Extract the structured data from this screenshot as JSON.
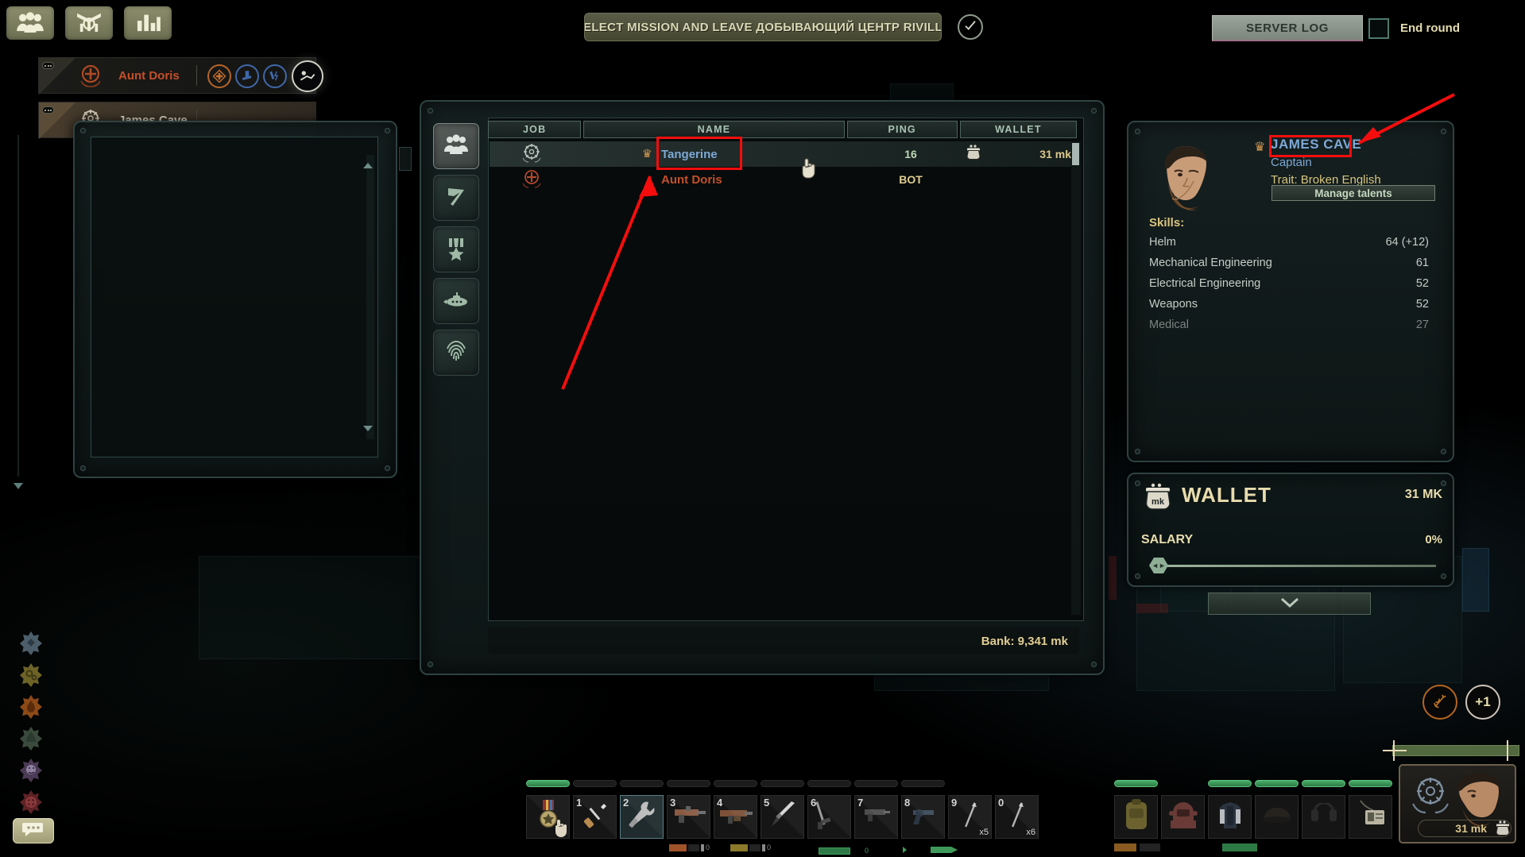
{
  "top_bar": {
    "icon_buttons": [
      {
        "name": "crew-icon",
        "label": "Crew"
      },
      {
        "name": "ship-command-icon",
        "label": "Command"
      },
      {
        "name": "stats-icon",
        "label": "Statistics"
      }
    ],
    "mission_banner": "SELECT MISSION AND LEAVE ДОБЫВАЮЩИЙ ЦЕНТР RIVILLE",
    "mission_check_icon": "check-circle-icon",
    "server_log_label": "SERVER LOG",
    "end_round_label": "End round",
    "end_round_checked": false
  },
  "crew_status_strips": [
    {
      "name": "Aunt Doris",
      "job_icon": "medic-emblem-icon",
      "color": "#c4502a",
      "status_icons": [
        "medical-cross-icon",
        "splint-icon",
        "defibrillator-icon",
        "unconscious-icon"
      ]
    },
    {
      "name": "James Cave",
      "job_icon": "captain-wheel-emblem-icon",
      "color": "#cfc8b4",
      "status_icons": []
    }
  ],
  "crew_panel": {
    "tabs": [
      {
        "name": "tab-crew",
        "icon": "people-icon",
        "active": true
      },
      {
        "name": "tab-missions",
        "icon": "flag-icon",
        "active": false
      },
      {
        "name": "tab-talents",
        "icon": "medal-icon",
        "active": false
      },
      {
        "name": "tab-submarine",
        "icon": "submarine-icon",
        "active": false
      },
      {
        "name": "tab-traitor",
        "icon": "fingerprint-icon",
        "active": false
      }
    ],
    "columns": [
      "JOB",
      "NAME",
      "PING",
      "WALLET"
    ],
    "rows": [
      {
        "job_icon": "captain-wheel-emblem-icon",
        "crown": true,
        "name": "Tangerine",
        "name_color": "#7da8d6",
        "ping": "16",
        "ping_color": "#bcd9b6",
        "wallet": "31 mk",
        "wallet_icon": "purse-icon",
        "selected": true
      },
      {
        "job_icon": "medic-emblem-icon",
        "crown": false,
        "name": "Aunt Doris",
        "name_color": "#c4502a",
        "ping": "BOT",
        "ping_color": "#e0cd92",
        "wallet": "",
        "wallet_icon": "",
        "selected": false
      }
    ],
    "bank_label": "Bank: 9,341 mk"
  },
  "character_info": {
    "portrait_icon": "bearded-captain-portrait",
    "crown_icon": "crown-icon",
    "name": "JAMES CAVE",
    "job": "Captain",
    "trait": "Trait: Broken English",
    "manage_talents_label": "Manage talents",
    "skills_header": "Skills:",
    "skills": [
      {
        "name": "Helm",
        "value": "64 (+12)",
        "dim": false
      },
      {
        "name": "Mechanical Engineering",
        "value": "61",
        "dim": false
      },
      {
        "name": "Electrical Engineering",
        "value": "52",
        "dim": false
      },
      {
        "name": "Weapons",
        "value": "52",
        "dim": false
      },
      {
        "name": "Medical",
        "value": "27",
        "dim": true
      }
    ]
  },
  "wallet_panel": {
    "icon": "wallet-mk-icon",
    "title": "WALLET",
    "amount": "31 MK",
    "salary_label": "SALARY",
    "salary_percent": "0%",
    "salary_slider_value": 0,
    "collapse_icon": "chevron-down-icon"
  },
  "afflictions": [
    {
      "name": "affliction-pressure-icon",
      "color": "#4d5e6b"
    },
    {
      "name": "affliction-radiation-icon",
      "color": "#6e6326"
    },
    {
      "name": "affliction-burn-icon",
      "color": "#8c4a17"
    },
    {
      "name": "affliction-poison-icon",
      "color": "#3a4a3c"
    },
    {
      "name": "affliction-psychosis-icon",
      "color": "#4b3a55"
    },
    {
      "name": "affliction-bleeding-icon",
      "color": "#5d2226"
    }
  ],
  "chat_button_icon": "chat-bubble-icon",
  "hotbar_left": {
    "slots": [
      {
        "num": "",
        "item": "medal-icon",
        "qty": "",
        "health": "full",
        "highlight": false
      },
      {
        "num": "1",
        "item": "screwdriver-icon",
        "qty": "",
        "health": "empty",
        "highlight": false
      },
      {
        "num": "2",
        "item": "wrench-icon",
        "qty": "",
        "health": "empty",
        "highlight": true
      },
      {
        "num": "3",
        "item": "smg-icon",
        "qty": "",
        "health": "empty",
        "highlight": false
      },
      {
        "num": "4",
        "item": "assault-rifle-icon",
        "qty": "",
        "health": "empty",
        "highlight": false
      },
      {
        "num": "5",
        "item": "combat-knife-icon",
        "qty": "",
        "health": "empty",
        "highlight": false
      },
      {
        "num": "6",
        "item": "harpoon-gun-icon",
        "qty": "",
        "health": "empty",
        "highlight": false
      },
      {
        "num": "7",
        "item": "machine-pistol-icon",
        "qty": "",
        "health": "empty",
        "highlight": false
      },
      {
        "num": "8",
        "item": "revolver-icon",
        "qty": "",
        "health": "empty",
        "highlight": false
      },
      {
        "num": "9",
        "item": "harpoon-icon",
        "qty": "x5",
        "health": "",
        "highlight": false
      },
      {
        "num": "0",
        "item": "harpoon-icon",
        "qty": "x6",
        "health": "",
        "highlight": false
      }
    ]
  },
  "hotbar_right": {
    "slots": [
      {
        "item": "backpack-icon",
        "health": "full"
      },
      {
        "item": "diving-helmet-icon",
        "health": "empty"
      },
      {
        "item": "diving-suit-icon",
        "health": "full"
      },
      {
        "item": "captain-hat-icon",
        "health": "full"
      },
      {
        "item": "headset-icon",
        "health": "full"
      },
      {
        "item": "id-card-icon",
        "health": "full"
      }
    ]
  },
  "bottom_right": {
    "skill_buttons": [
      {
        "name": "bone-skill-icon",
        "label": ""
      },
      {
        "name": "plus-one-badge",
        "label": "+1"
      }
    ],
    "portrait_card": {
      "job_icon": "captain-wheel-emblem-icon",
      "face_icon": "bearded-captain-portrait",
      "money": "31 mk",
      "purse_icon": "purse-icon"
    }
  },
  "annotations": {
    "highlight_boxes": [
      {
        "name": "tangerine-name-highlight",
        "color": "#f50d0d"
      },
      {
        "name": "james-cave-name-highlight",
        "color": "#f50d0d"
      }
    ],
    "arrows": [
      {
        "name": "arrow-to-tangerine",
        "color": "#f50d0d"
      },
      {
        "name": "arrow-to-james-cave",
        "color": "#f50d0d"
      }
    ]
  }
}
